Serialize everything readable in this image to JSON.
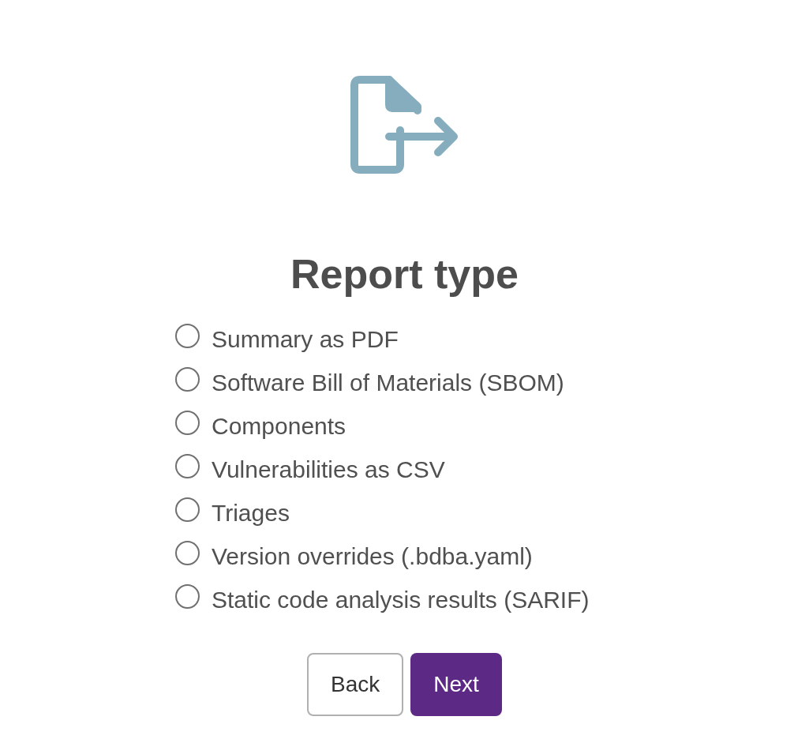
{
  "title": "Report type",
  "options": [
    {
      "label": "Summary as PDF",
      "selected": false
    },
    {
      "label": "Software Bill of Materials (SBOM)",
      "selected": false
    },
    {
      "label": "Components",
      "selected": false
    },
    {
      "label": "Vulnerabilities as CSV",
      "selected": false
    },
    {
      "label": "Triages",
      "selected": false
    },
    {
      "label": "Version overrides (.bdba.yaml)",
      "selected": false
    },
    {
      "label": "Static code analysis results (SARIF)",
      "selected": false
    }
  ],
  "buttons": [
    {
      "label": "Back",
      "kind": "secondary"
    },
    {
      "label": "Next",
      "kind": "primary"
    }
  ]
}
